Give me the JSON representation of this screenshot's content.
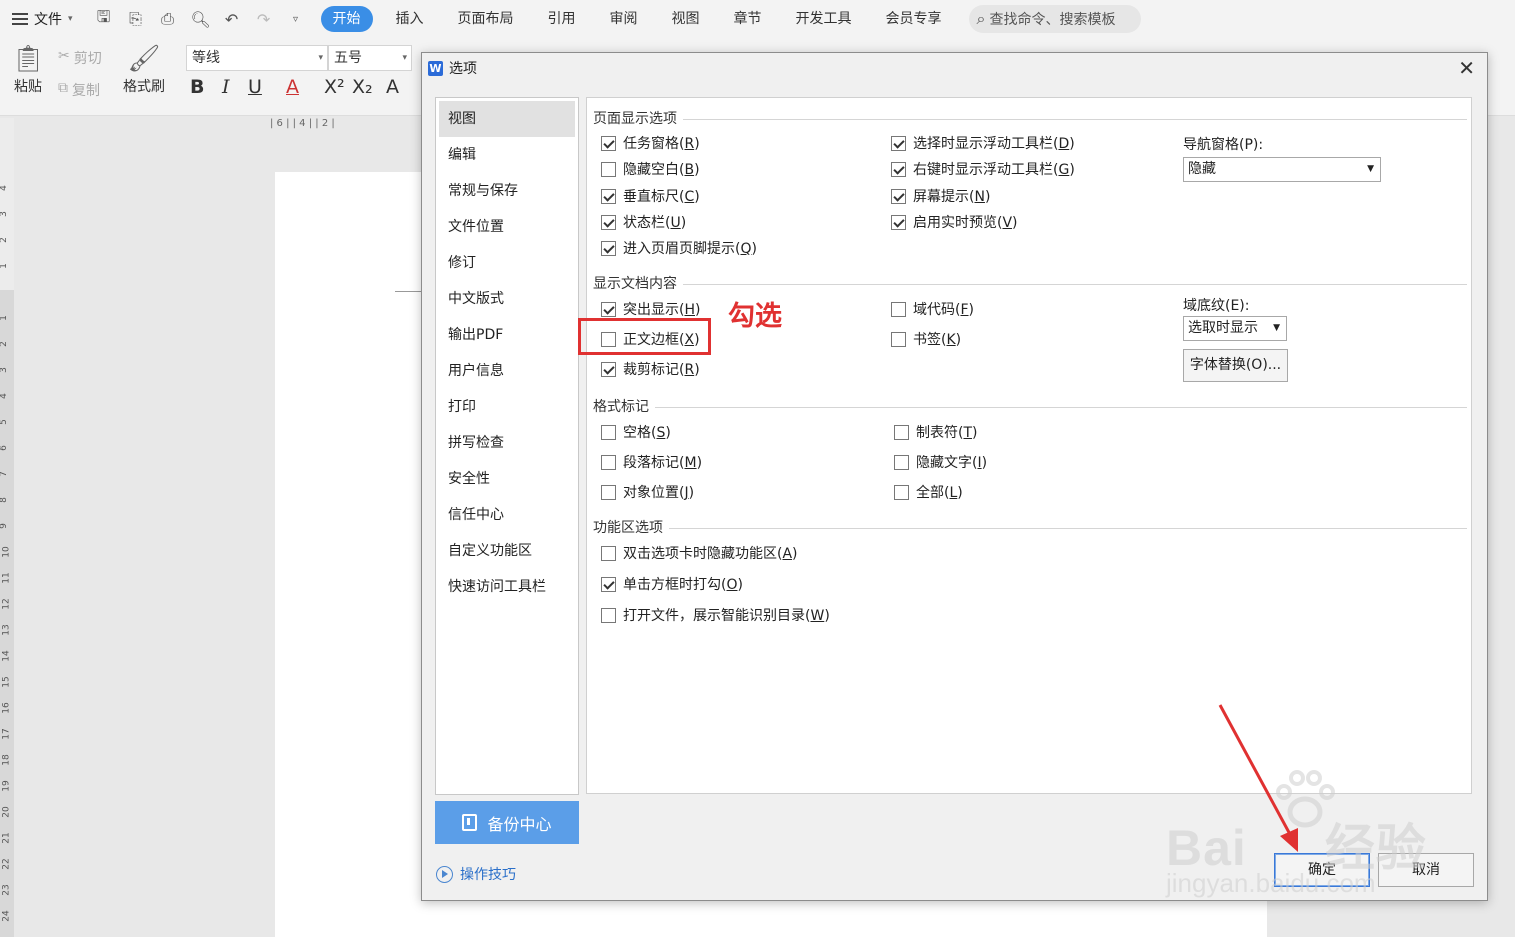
{
  "menubar": {
    "file_label": "文件",
    "tabs": [
      "开始",
      "插入",
      "页面布局",
      "引用",
      "审阅",
      "视图",
      "章节",
      "开发工具",
      "会员专享"
    ],
    "search_placeholder": "查找命令、搜索模板"
  },
  "ribbon": {
    "paste": "粘贴",
    "cut": "剪切",
    "copy": "复制",
    "format_painter": "格式刷",
    "font_name": "等线",
    "font_size": "五号"
  },
  "ruler": {
    "h_marks": "| 6 |  | 4 |  | 2 |",
    "v_numbers": [
      "4",
      "3",
      "2",
      "1",
      "1",
      "2",
      "3",
      "4",
      "5",
      "6",
      "7",
      "8",
      "9",
      "10",
      "11",
      "12",
      "13",
      "14",
      "15",
      "16",
      "17",
      "18",
      "19",
      "20",
      "21",
      "22",
      "23",
      "24"
    ]
  },
  "dialog": {
    "title": "选项",
    "nav": [
      "视图",
      "编辑",
      "常规与保存",
      "文件位置",
      "修订",
      "中文版式",
      "输出PDF",
      "用户信息",
      "打印",
      "拼写检查",
      "安全性",
      "信任中心",
      "自定义功能区",
      "快速访问工具栏"
    ],
    "backup_label": "备份中心",
    "tips_label": "操作技巧",
    "sections": {
      "page_display": "页面显示选项",
      "doc_content": "显示文档内容",
      "format_marks": "格式标记",
      "ribbon_options": "功能区选项"
    },
    "page_display": {
      "col1": [
        {
          "label": "任务窗格(",
          "key": "R",
          "checked": true
        },
        {
          "label": "隐藏空白(",
          "key": "B",
          "checked": false
        },
        {
          "label": "垂直标尺(",
          "key": "C",
          "checked": true
        },
        {
          "label": "状态栏(",
          "key": "U",
          "checked": true
        },
        {
          "label": "进入页眉页脚提示(",
          "key": "Q",
          "checked": true
        }
      ],
      "col2": [
        {
          "label": "选择时显示浮动工具栏(",
          "key": "D",
          "checked": true
        },
        {
          "label": "右键时显示浮动工具栏(",
          "key": "G",
          "checked": true
        },
        {
          "label": "屏幕提示(",
          "key": "N",
          "checked": true
        },
        {
          "label": "启用实时预览(",
          "key": "V",
          "checked": true
        }
      ],
      "nav_pane_label": "导航窗格(P):",
      "nav_pane_value": "隐藏"
    },
    "doc_content": {
      "col1": [
        {
          "label": "突出显示(",
          "key": "H",
          "checked": true
        },
        {
          "label": "正文边框(",
          "key": "X",
          "checked": false
        },
        {
          "label": "裁剪标记(",
          "key": "R",
          "checked": true
        }
      ],
      "col2": [
        {
          "label": "域代码(",
          "key": "F",
          "checked": false
        },
        {
          "label": "书签(",
          "key": "K",
          "checked": false
        }
      ],
      "field_shading_label": "域底纹(E):",
      "field_shading_value": "选取时显示",
      "font_substitution": "字体替换(O)..."
    },
    "format_marks": {
      "col1": [
        {
          "label": "空格(",
          "key": "S",
          "checked": false
        },
        {
          "label": "段落标记(",
          "key": "M",
          "checked": false
        },
        {
          "label": "对象位置(",
          "key": "J",
          "checked": false
        }
      ],
      "col2": [
        {
          "label": "制表符(",
          "key": "T",
          "checked": false
        },
        {
          "label": "隐藏文字(",
          "key": "I",
          "checked": false
        },
        {
          "label": "全部(",
          "key": "L",
          "checked": false
        }
      ]
    },
    "ribbon_options": [
      {
        "label": "双击选项卡时隐藏功能区(",
        "key": "A",
        "checked": false
      },
      {
        "label": "单击方框时打勾(",
        "key": "O",
        "checked": true
      },
      {
        "label": "打开文件，展示智能识别目录(",
        "key": "W",
        "checked": false
      }
    ],
    "ok": "确定",
    "cancel": "取消"
  },
  "annotation": {
    "text": "勾选",
    "color": "#e03131"
  },
  "watermark": {
    "main": "Bai",
    "brand": "经验",
    "sub": "jingyan.baidu.com"
  },
  "colors": {
    "accent": "#3a8ee6",
    "backup_bg": "#5b9ee8"
  }
}
